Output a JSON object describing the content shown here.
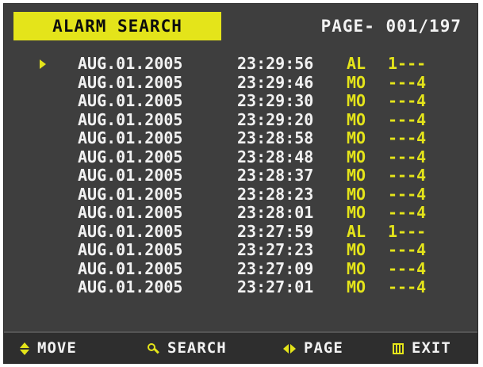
{
  "header": {
    "title": "ALARM SEARCH",
    "page_indicator": "PAGE- 001/197"
  },
  "records": [
    {
      "date": "AUG.01.2005",
      "time": "23:29:56",
      "type": "AL",
      "channels": "1---",
      "selected": true
    },
    {
      "date": "AUG.01.2005",
      "time": "23:29:46",
      "type": "MO",
      "channels": "---4",
      "selected": false
    },
    {
      "date": "AUG.01.2005",
      "time": "23:29:30",
      "type": "MO",
      "channels": "---4",
      "selected": false
    },
    {
      "date": "AUG.01.2005",
      "time": "23:29:20",
      "type": "MO",
      "channels": "---4",
      "selected": false
    },
    {
      "date": "AUG.01.2005",
      "time": "23:28:58",
      "type": "MO",
      "channels": "---4",
      "selected": false
    },
    {
      "date": "AUG.01.2005",
      "time": "23:28:48",
      "type": "MO",
      "channels": "---4",
      "selected": false
    },
    {
      "date": "AUG.01.2005",
      "time": "23:28:37",
      "type": "MO",
      "channels": "---4",
      "selected": false
    },
    {
      "date": "AUG.01.2005",
      "time": "23:28:23",
      "type": "MO",
      "channels": "---4",
      "selected": false
    },
    {
      "date": "AUG.01.2005",
      "time": "23:28:01",
      "type": "MO",
      "channels": "---4",
      "selected": false
    },
    {
      "date": "AUG.01.2005",
      "time": "23:27:59",
      "type": "AL",
      "channels": "1---",
      "selected": false
    },
    {
      "date": "AUG.01.2005",
      "time": "23:27:23",
      "type": "MO",
      "channels": "---4",
      "selected": false
    },
    {
      "date": "AUG.01.2005",
      "time": "23:27:09",
      "type": "MO",
      "channels": "---4",
      "selected": false
    },
    {
      "date": "AUG.01.2005",
      "time": "23:27:01",
      "type": "MO",
      "channels": "---4",
      "selected": false
    }
  ],
  "footer": {
    "move_label": "MOVE",
    "move_icon": "up-down-arrows-icon",
    "search_label": "SEARCH",
    "search_icon": "search-icon",
    "page_label": "PAGE",
    "page_icon": "left-right-arrows-icon",
    "exit_label": "EXIT",
    "exit_icon": "menu-icon"
  },
  "colors": {
    "accent": "#e4e41a",
    "text": "#f2f2f2",
    "background": "#3e3e3e"
  }
}
